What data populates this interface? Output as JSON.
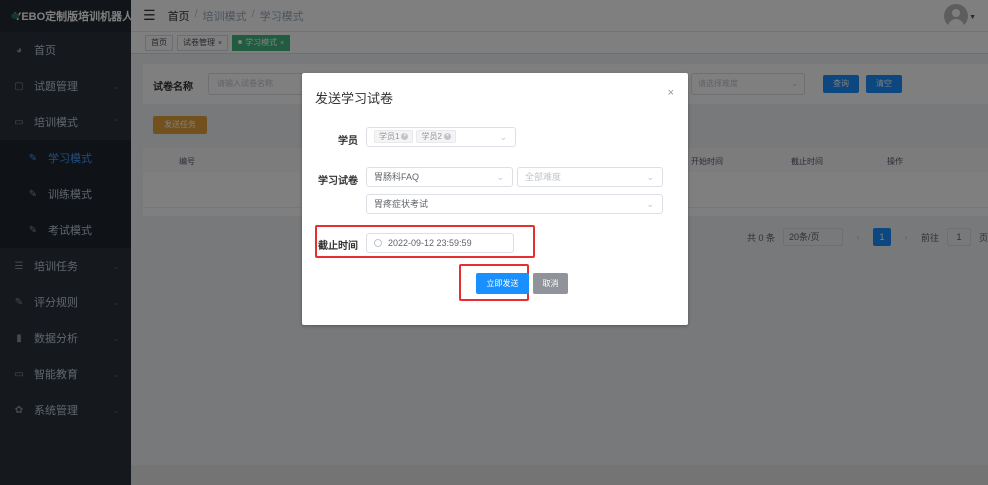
{
  "app": {
    "title": "YEBO定制版培训机器人"
  },
  "sidebar": {
    "items": [
      {
        "label": "首页",
        "icon": "speedometer-icon"
      },
      {
        "label": "试题管理",
        "icon": "document-icon"
      },
      {
        "label": "培训模式",
        "icon": "monitor-icon"
      },
      {
        "label": "培训任务",
        "icon": "list-icon"
      },
      {
        "label": "评分规则",
        "icon": "edit-icon"
      },
      {
        "label": "数据分析",
        "icon": "bar-chart-icon"
      },
      {
        "label": "智能教育",
        "icon": "screen-icon"
      },
      {
        "label": "系统管理",
        "icon": "gear-icon"
      }
    ],
    "submenu": [
      {
        "label": "学习模式",
        "active": true
      },
      {
        "label": "训练模式"
      },
      {
        "label": "考试模式"
      }
    ]
  },
  "header": {
    "breadcrumb": [
      "首页",
      "培训模式",
      "学习模式"
    ]
  },
  "tags": [
    {
      "label": "首页"
    },
    {
      "label": "试卷管理"
    },
    {
      "label": "学习模式",
      "active": true
    }
  ],
  "search": {
    "label": "试卷名称",
    "placeholder": "请输入试卷名称",
    "select_placeholder": "请选择难度",
    "query_label": "查询",
    "clear_label": "清空"
  },
  "toolbar": {
    "task_label": "发送任务"
  },
  "table": {
    "columns": [
      "编号",
      "开始时间",
      "截止时间",
      "操作"
    ]
  },
  "pagination": {
    "total": "共 0 条",
    "page_size": "20条/页",
    "current_page": "1",
    "goto_label": "前往",
    "goto_value": "1",
    "page_unit": "页"
  },
  "dialog": {
    "title": "发送学习试卷",
    "close": "×",
    "student_label": "学员",
    "students": [
      "学员1",
      "学员2"
    ],
    "paper_label": "学习试卷",
    "paper_category": "胃肠科FAQ",
    "difficulty_placeholder": "全部难度",
    "paper_name": "胃疼症状考试",
    "deadline_label": "截止时间",
    "deadline_value": "2022-09-12 23:59:59",
    "send_label": "立即发送",
    "cancel_label": "取消"
  },
  "colors": {
    "primary": "#1890ff",
    "highlight": "#e5302f",
    "sidebar_bg": "#2b323c",
    "active_tag": "#42b983",
    "task_button": "#e6a23c"
  }
}
